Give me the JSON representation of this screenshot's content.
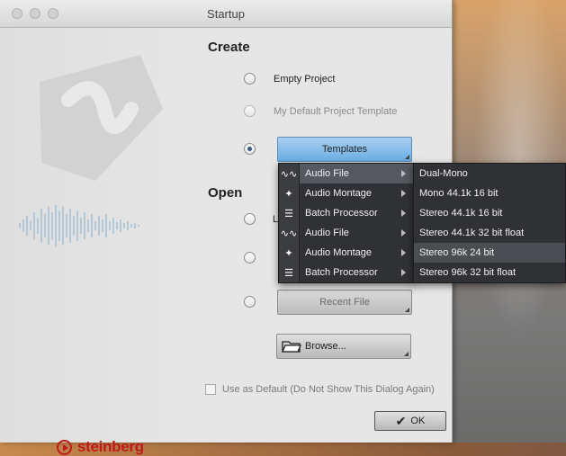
{
  "window": {
    "title": "Startup"
  },
  "brand": {
    "name": "steinberg"
  },
  "create": {
    "heading": "Create",
    "options": [
      {
        "label": "Empty Project"
      },
      {
        "label": "My Default Project Template"
      }
    ],
    "templates_button": "Templates"
  },
  "open": {
    "heading": "Open",
    "recent_file_button": "Recent File",
    "browse_button": "Browse..."
  },
  "templates_menu": {
    "items": [
      {
        "label": "Audio File",
        "icon": "wave-icon",
        "glyph": "∿∿"
      },
      {
        "label": "Audio Montage",
        "icon": "montage-icon",
        "glyph": "✦"
      },
      {
        "label": "Batch Processor",
        "icon": "batch-icon",
        "glyph": "☰"
      },
      {
        "label": "Audio File",
        "icon": "wave-icon",
        "glyph": "∿∿"
      },
      {
        "label": "Audio Montage",
        "icon": "montage-icon",
        "glyph": "✦"
      },
      {
        "label": "Batch Processor",
        "icon": "batch-icon",
        "glyph": "☰"
      }
    ]
  },
  "audio_file_submenu": {
    "items": [
      "Dual-Mono",
      "Mono 44.1k 16 bit",
      "Stereo 44.1k 16 bit",
      "Stereo 44.1k 32 bit float",
      "Stereo 96k 24 bit",
      "Stereo 96k 32 bit float"
    ]
  },
  "footer": {
    "use_default_label": "Use as Default (Do Not Show This Dialog Again)",
    "ok_button": "OK"
  },
  "colors": {
    "accent": "#6aaee4",
    "brand_red": "#c01b1b",
    "menu_bg": "#2f3135"
  }
}
